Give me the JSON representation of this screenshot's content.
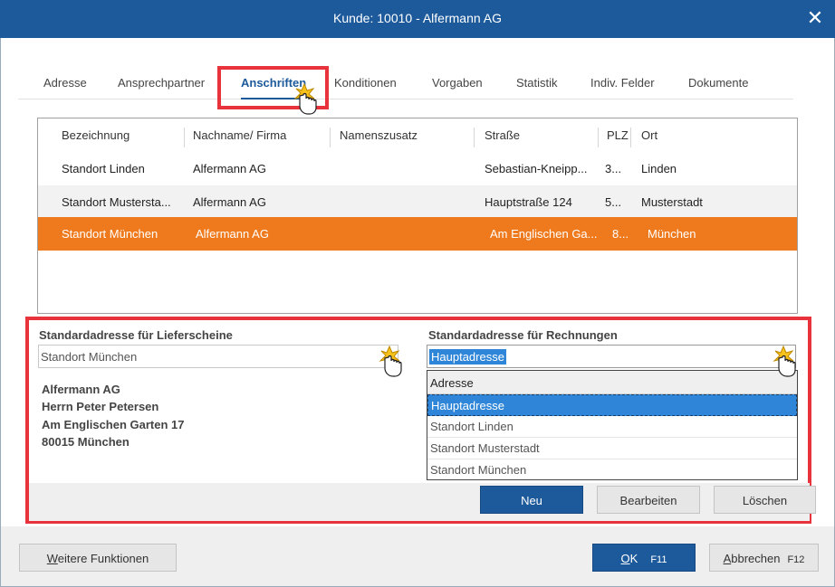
{
  "window": {
    "title": "Kunde: 10010 - Alfermann AG",
    "close_label": "✕"
  },
  "tabs": [
    {
      "label": "Adresse"
    },
    {
      "label": "Ansprechpartner"
    },
    {
      "label": "Anschriften"
    },
    {
      "label": "Konditionen"
    },
    {
      "label": "Vorgaben"
    },
    {
      "label": "Statistik"
    },
    {
      "label": "Indiv. Felder"
    },
    {
      "label": "Dokumente"
    }
  ],
  "active_tab": "Anschriften",
  "table": {
    "columns": [
      "Bezeichnung",
      "Nachname/ Firma",
      "Namenszusatz",
      "Straße",
      "PLZ",
      "Ort"
    ],
    "rows": [
      {
        "bezeichnung": "Standort Linden",
        "firma": "Alfermann AG",
        "zusatz": "",
        "strasse": "Sebastian-Kneipp...",
        "plz": "3...",
        "ort": "Linden"
      },
      {
        "bezeichnung": "Standort Mustersta...",
        "firma": "Alfermann AG",
        "zusatz": "",
        "strasse": "Hauptstraße 124",
        "plz": "5...",
        "ort": "Musterstadt"
      },
      {
        "bezeichnung": "Standort München",
        "firma": "Alfermann AG",
        "zusatz": "",
        "strasse": "Am Englischen Ga...",
        "plz": "8...",
        "ort": "München"
      }
    ],
    "selected_row": 2
  },
  "lieferscheine": {
    "label": "Standardadresse für Lieferscheine",
    "value": "Standort München",
    "address": [
      "Alfermann AG",
      "Herrn Peter Petersen",
      "Am Englischen Garten 17",
      "80015 München"
    ]
  },
  "rechnungen": {
    "label": "Standardadresse für Rechnungen",
    "value": "Hauptadresse",
    "dropdown_header": "Adresse",
    "options": [
      "Hauptadresse",
      "Standort Linden",
      "Standort Musterstadt",
      "Standort München"
    ],
    "selected_option": 0
  },
  "buttons": {
    "neu": "Neu",
    "bearbeiten": "Bearbeiten",
    "loeschen": "Löschen"
  },
  "footer": {
    "weitere_first": "W",
    "weitere_rest": "eitere Funktionen",
    "ok_first": "O",
    "ok_rest": "K",
    "ok_key": "F11",
    "abbrechen_first": "A",
    "abbrechen_rest": "bbrechen",
    "abbrechen_key": "F12"
  },
  "colors": {
    "accent": "#1d5a9c",
    "selection_row": "#ef7a1d",
    "highlight_frame": "#e8323c",
    "dropdown_selection": "#2f86d8"
  }
}
